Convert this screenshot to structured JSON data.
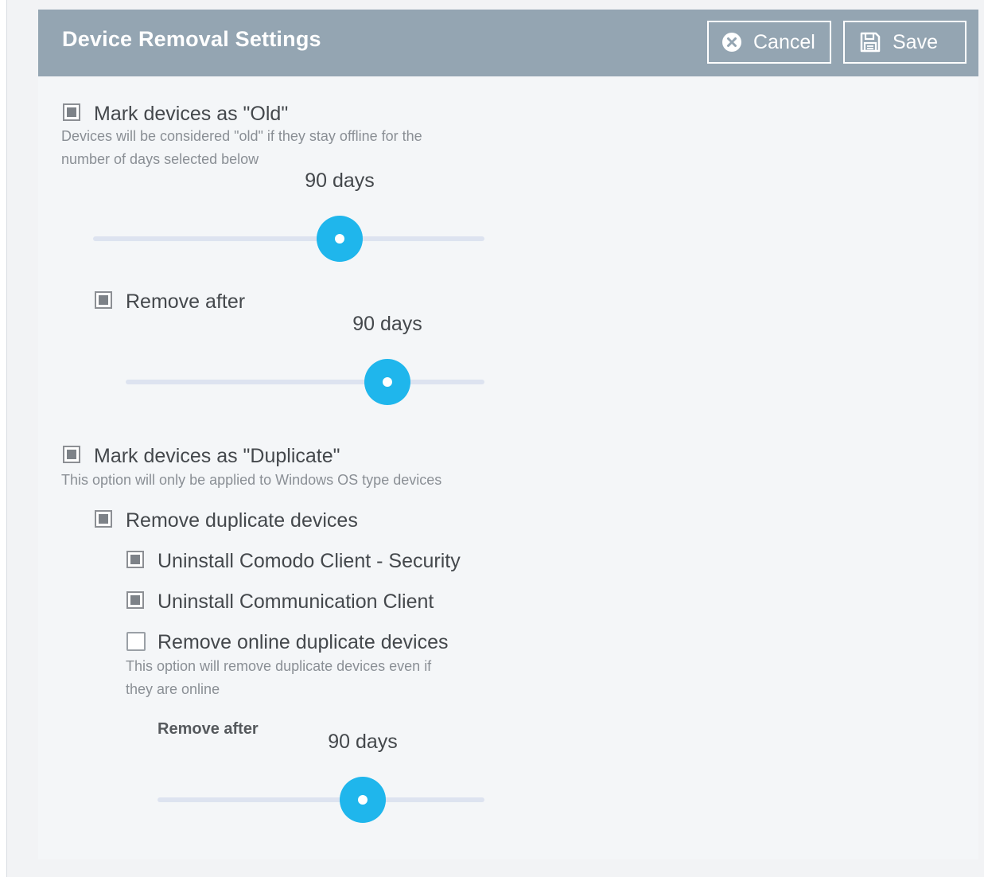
{
  "header": {
    "title": "Device Removal Settings",
    "cancel_label": "Cancel",
    "save_label": "Save",
    "cancel_icon": "x-circle-icon",
    "save_icon": "floppy-disk-icon",
    "background": "#94a5b2"
  },
  "old": {
    "label": "Mark devices as \"Old\"",
    "checked": true,
    "help_line1": "Devices will be considered \"old\" if they stay offline for the",
    "help_line2": "number of days selected below",
    "slider_value": "90 days",
    "remove_after": {
      "label": "Remove after",
      "checked": true,
      "slider_value": "90 days"
    }
  },
  "duplicate": {
    "label": "Mark devices as \"Duplicate\"",
    "checked": true,
    "help": "This option will only be applied to Windows OS type devices",
    "remove_duplicates": {
      "label": "Remove duplicate devices",
      "checked": true
    },
    "uninstall_security": {
      "label": "Uninstall Comodo Client - Security",
      "checked": true
    },
    "uninstall_communication": {
      "label": "Uninstall Communication Client",
      "checked": true
    },
    "remove_online": {
      "label": "Remove online duplicate devices",
      "checked": false,
      "help_line1": "This option will remove duplicate devices even if",
      "help_line2": "they are online"
    },
    "remove_after_label": "Remove after",
    "slider_value": "90 days"
  },
  "colors": {
    "slider_knob": "#1fb6ec",
    "slider_track": "#dde3f0",
    "panel_bg": "#f4f6f8"
  }
}
